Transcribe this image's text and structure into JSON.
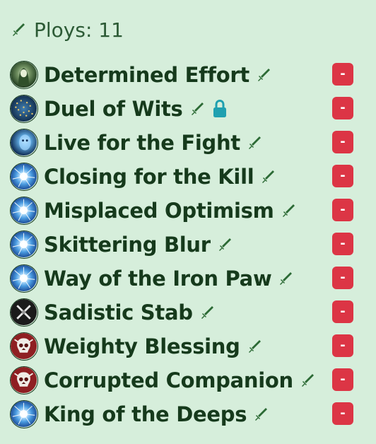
{
  "header": {
    "label": "Ploys: 11",
    "icon": "sword-icon"
  },
  "colors": {
    "background": "#d6eedb",
    "text": "#163a1c",
    "remove_button": "#dc3545",
    "lock": "#1fa0b0"
  },
  "ploys": [
    {
      "name": "Determined Effort",
      "avatar": "green-hooded-figure",
      "locked": false
    },
    {
      "name": "Duel of Wits",
      "avatar": "blue-starry",
      "locked": true
    },
    {
      "name": "Live for the Fight",
      "avatar": "blue-face",
      "locked": false
    },
    {
      "name": "Closing for the Kill",
      "avatar": "blue-burst",
      "locked": false
    },
    {
      "name": "Misplaced Optimism",
      "avatar": "blue-burst",
      "locked": false
    },
    {
      "name": "Skittering Blur",
      "avatar": "blue-burst",
      "locked": false
    },
    {
      "name": "Way of the Iron Paw",
      "avatar": "blue-burst",
      "locked": false
    },
    {
      "name": "Sadistic Stab",
      "avatar": "black-crossed-blades",
      "locked": false
    },
    {
      "name": "Weighty Blessing",
      "avatar": "red-skull",
      "locked": false
    },
    {
      "name": "Corrupted Companion",
      "avatar": "red-skull",
      "locked": false
    },
    {
      "name": "King of the Deeps",
      "avatar": "blue-burst",
      "locked": false
    }
  ],
  "remove_label": "-"
}
